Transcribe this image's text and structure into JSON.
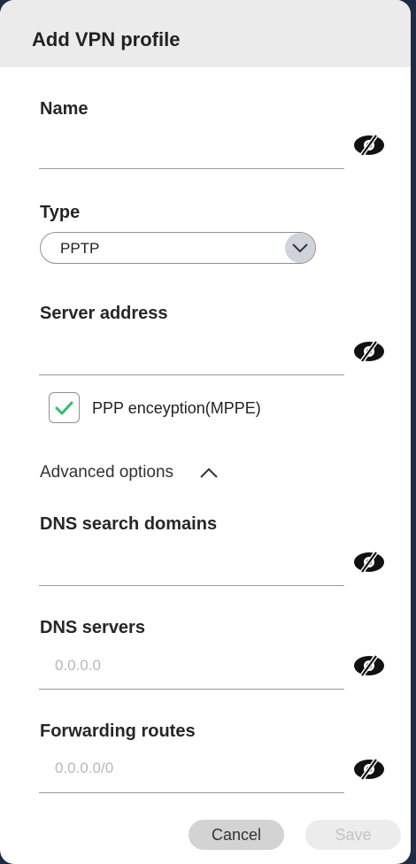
{
  "dialog": {
    "title": "Add VPN profile",
    "name": {
      "label": "Name",
      "value": ""
    },
    "type": {
      "label": "Type",
      "selected": "PPTP"
    },
    "server_address": {
      "label": "Server address",
      "value": ""
    },
    "ppp_encryption": {
      "label": "PPP enceyption(MPPE)",
      "checked": true
    },
    "advanced_options": {
      "label": "Advanced options",
      "expanded": true
    },
    "dns_search_domains": {
      "label": "DNS search domains",
      "value": ""
    },
    "dns_servers": {
      "label": "DNS servers",
      "placeholder": "0.0.0.0"
    },
    "forwarding_routes": {
      "label": "Forwarding routes",
      "placeholder": "0.0.0.0/0"
    },
    "buttons": {
      "cancel": "Cancel",
      "save": "Save"
    }
  },
  "colors": {
    "accent_check": "#2fbf71",
    "header_bg": "#ebebeb",
    "chevron_bg": "#cfd4db",
    "eye_icon": "#111111"
  },
  "icons": {
    "visibility_toggle": "eye-off-icon",
    "dropdown": "chevron-down-icon",
    "advanced_toggle": "chevron-up-icon",
    "checkbox_mark": "checkmark-icon"
  }
}
